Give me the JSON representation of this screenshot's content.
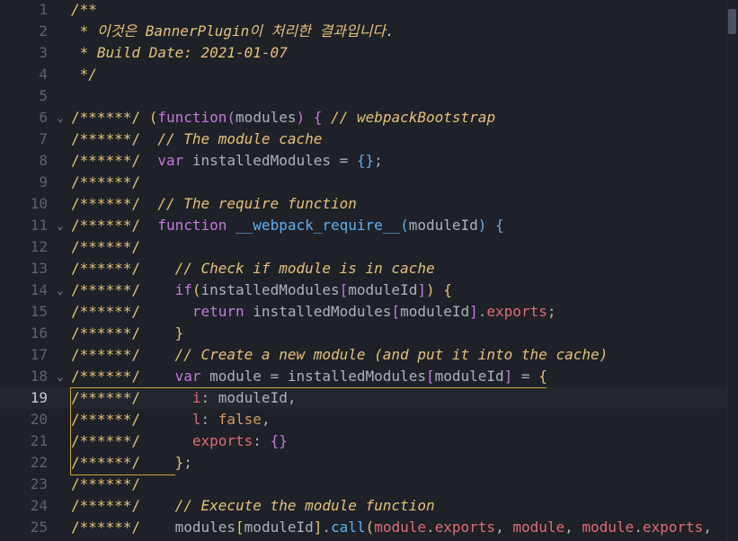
{
  "editor": {
    "lines": [
      {
        "n": "1",
        "fold": false,
        "tokens": [
          {
            "c": "c-cm",
            "t": "/**"
          }
        ]
      },
      {
        "n": "2",
        "fold": false,
        "tokens": [
          {
            "c": "c-cm",
            "t": " * 이것은 BannerPlugin이 처리한 결과입니다."
          }
        ]
      },
      {
        "n": "3",
        "fold": false,
        "tokens": [
          {
            "c": "c-cm",
            "t": " * Build Date: 2021-01-07"
          }
        ]
      },
      {
        "n": "4",
        "fold": false,
        "tokens": [
          {
            "c": "c-cm",
            "t": " */"
          }
        ]
      },
      {
        "n": "5",
        "fold": false,
        "tokens": []
      },
      {
        "n": "6",
        "fold": true,
        "tokens": [
          {
            "c": "c-mark",
            "t": "/******/ "
          },
          {
            "c": "c-br1",
            "t": "("
          },
          {
            "c": "c-kw",
            "t": "function"
          },
          {
            "c": "c-br2",
            "t": "("
          },
          {
            "c": "c-var",
            "t": "modules"
          },
          {
            "c": "c-br2",
            "t": ")"
          },
          {
            "c": "c-pun",
            "t": " "
          },
          {
            "c": "c-br2",
            "t": "{"
          },
          {
            "c": "c-pun",
            "t": " "
          },
          {
            "c": "c-cm",
            "t": "// webpackBootstrap"
          }
        ]
      },
      {
        "n": "7",
        "fold": false,
        "tokens": [
          {
            "c": "c-mark",
            "t": "/******/  "
          },
          {
            "c": "c-cm",
            "t": "// The module cache"
          }
        ]
      },
      {
        "n": "8",
        "fold": false,
        "tokens": [
          {
            "c": "c-mark",
            "t": "/******/  "
          },
          {
            "c": "c-kw",
            "t": "var"
          },
          {
            "c": "c-var",
            "t": " installedModules "
          },
          {
            "c": "c-pun",
            "t": "= "
          },
          {
            "c": "c-br3",
            "t": "{}"
          },
          {
            "c": "c-pun",
            "t": ";"
          }
        ]
      },
      {
        "n": "9",
        "fold": false,
        "tokens": [
          {
            "c": "c-mark",
            "t": "/******/"
          }
        ]
      },
      {
        "n": "10",
        "fold": false,
        "tokens": [
          {
            "c": "c-mark",
            "t": "/******/  "
          },
          {
            "c": "c-cm",
            "t": "// The require function"
          }
        ]
      },
      {
        "n": "11",
        "fold": true,
        "tokens": [
          {
            "c": "c-mark",
            "t": "/******/  "
          },
          {
            "c": "c-kw",
            "t": "function"
          },
          {
            "c": "c-pun",
            "t": " "
          },
          {
            "c": "c-fn",
            "t": "__webpack_require__"
          },
          {
            "c": "c-br3",
            "t": "("
          },
          {
            "c": "c-var",
            "t": "moduleId"
          },
          {
            "c": "c-br3",
            "t": ")"
          },
          {
            "c": "c-pun",
            "t": " "
          },
          {
            "c": "c-br3",
            "t": "{"
          }
        ]
      },
      {
        "n": "12",
        "fold": false,
        "tokens": [
          {
            "c": "c-mark",
            "t": "/******/"
          }
        ]
      },
      {
        "n": "13",
        "fold": false,
        "tokens": [
          {
            "c": "c-mark",
            "t": "/******/    "
          },
          {
            "c": "c-cm",
            "t": "// Check if module is in cache"
          }
        ]
      },
      {
        "n": "14",
        "fold": true,
        "tokens": [
          {
            "c": "c-mark",
            "t": "/******/    "
          },
          {
            "c": "c-kw",
            "t": "if"
          },
          {
            "c": "c-br1",
            "t": "("
          },
          {
            "c": "c-var",
            "t": "installedModules"
          },
          {
            "c": "c-br2",
            "t": "["
          },
          {
            "c": "c-var",
            "t": "moduleId"
          },
          {
            "c": "c-br2",
            "t": "]"
          },
          {
            "c": "c-br1",
            "t": ")"
          },
          {
            "c": "c-pun",
            "t": " "
          },
          {
            "c": "c-br1",
            "t": "{"
          }
        ]
      },
      {
        "n": "15",
        "fold": false,
        "tokens": [
          {
            "c": "c-mark",
            "t": "/******/      "
          },
          {
            "c": "c-kw",
            "t": "return"
          },
          {
            "c": "c-var",
            "t": " installedModules"
          },
          {
            "c": "c-br2",
            "t": "["
          },
          {
            "c": "c-var",
            "t": "moduleId"
          },
          {
            "c": "c-br2",
            "t": "]"
          },
          {
            "c": "c-pun",
            "t": "."
          },
          {
            "c": "c-prop",
            "t": "exports"
          },
          {
            "c": "c-pun",
            "t": ";"
          }
        ]
      },
      {
        "n": "16",
        "fold": false,
        "tokens": [
          {
            "c": "c-mark",
            "t": "/******/    "
          },
          {
            "c": "c-br1",
            "t": "}"
          }
        ]
      },
      {
        "n": "17",
        "fold": false,
        "tokens": [
          {
            "c": "c-mark",
            "t": "/******/    "
          },
          {
            "c": "c-cm",
            "t": "// Create a new module (and put it into the cache)"
          }
        ]
      },
      {
        "n": "18",
        "fold": true,
        "tokens": [
          {
            "c": "c-mark",
            "t": "/******/    "
          },
          {
            "c": "c-kw",
            "t": "var"
          },
          {
            "c": "c-var",
            "t": " module "
          },
          {
            "c": "c-pun",
            "t": "= "
          },
          {
            "c": "c-var",
            "t": "installedModules"
          },
          {
            "c": "c-br2",
            "t": "["
          },
          {
            "c": "c-var",
            "t": "moduleId"
          },
          {
            "c": "c-br2",
            "t": "]"
          },
          {
            "c": "c-pun",
            "t": " = "
          },
          {
            "c": "c-br1",
            "t": "{"
          }
        ]
      },
      {
        "n": "19",
        "fold": false,
        "current": true,
        "tokens": [
          {
            "c": "c-mark",
            "t": "/******/      "
          },
          {
            "c": "c-prop",
            "t": "i"
          },
          {
            "c": "c-pun",
            "t": ": "
          },
          {
            "c": "c-var",
            "t": "moduleId"
          },
          {
            "c": "c-pun",
            "t": ","
          }
        ]
      },
      {
        "n": "20",
        "fold": false,
        "tokens": [
          {
            "c": "c-mark",
            "t": "/******/      "
          },
          {
            "c": "c-prop",
            "t": "l"
          },
          {
            "c": "c-pun",
            "t": ": "
          },
          {
            "c": "c-bool",
            "t": "false"
          },
          {
            "c": "c-pun",
            "t": ","
          }
        ]
      },
      {
        "n": "21",
        "fold": false,
        "tokens": [
          {
            "c": "c-mark",
            "t": "/******/      "
          },
          {
            "c": "c-prop",
            "t": "exports"
          },
          {
            "c": "c-pun",
            "t": ": "
          },
          {
            "c": "c-br2",
            "t": "{}"
          }
        ]
      },
      {
        "n": "22",
        "fold": false,
        "tokens": [
          {
            "c": "c-mark",
            "t": "/******/    "
          },
          {
            "c": "c-br1",
            "t": "}"
          },
          {
            "c": "c-pun",
            "t": ";"
          }
        ]
      },
      {
        "n": "23",
        "fold": false,
        "tokens": [
          {
            "c": "c-mark",
            "t": "/******/"
          }
        ]
      },
      {
        "n": "24",
        "fold": false,
        "tokens": [
          {
            "c": "c-mark",
            "t": "/******/    "
          },
          {
            "c": "c-cm",
            "t": "// Execute the module function"
          }
        ]
      },
      {
        "n": "25",
        "fold": false,
        "tokens": [
          {
            "c": "c-mark",
            "t": "/******/    "
          },
          {
            "c": "c-var",
            "t": "modules"
          },
          {
            "c": "c-br1",
            "t": "["
          },
          {
            "c": "c-var",
            "t": "moduleId"
          },
          {
            "c": "c-br1",
            "t": "]"
          },
          {
            "c": "c-pun",
            "t": "."
          },
          {
            "c": "c-fn",
            "t": "call"
          },
          {
            "c": "c-br1",
            "t": "("
          },
          {
            "c": "c-prop",
            "t": "module"
          },
          {
            "c": "c-pun",
            "t": "."
          },
          {
            "c": "c-prop",
            "t": "exports"
          },
          {
            "c": "c-pun",
            "t": ", "
          },
          {
            "c": "c-prop",
            "t": "module"
          },
          {
            "c": "c-pun",
            "t": ", "
          },
          {
            "c": "c-prop",
            "t": "module"
          },
          {
            "c": "c-pun",
            "t": "."
          },
          {
            "c": "c-prop",
            "t": "exports"
          },
          {
            "c": "c-pun",
            "t": ","
          }
        ]
      }
    ],
    "icons": {
      "fold": "chevron-down-icon"
    },
    "colors": {
      "background": "#1e2127",
      "comment": "#e5c07b",
      "keyword": "#c678dd",
      "function": "#61afef",
      "property": "#e06c75",
      "boolean": "#d19a66"
    }
  }
}
